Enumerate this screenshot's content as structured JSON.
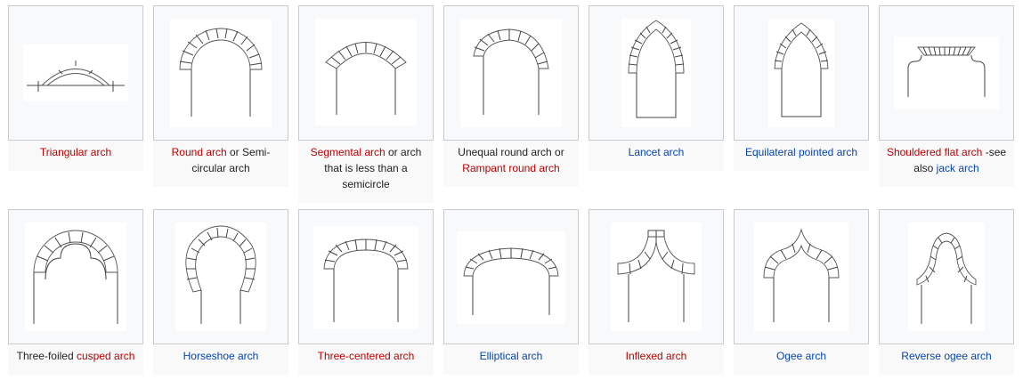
{
  "gallery": {
    "items": [
      {
        "key": "triangular",
        "caption": [
          {
            "text": "Triangular arch",
            "link": "red"
          }
        ]
      },
      {
        "key": "round",
        "caption": [
          {
            "text": "Round arch",
            "link": "red"
          },
          {
            "text": " or Semi-circular arch",
            "link": ""
          }
        ]
      },
      {
        "key": "segmental",
        "caption": [
          {
            "text": "Segmental arch",
            "link": "red"
          },
          {
            "text": " or arch that is less than a semicircle",
            "link": ""
          }
        ]
      },
      {
        "key": "unequal",
        "caption": [
          {
            "text": "Unequal round arch or ",
            "link": ""
          },
          {
            "text": "Rampant round arch",
            "link": "red"
          }
        ]
      },
      {
        "key": "lancet",
        "caption": [
          {
            "text": "Lancet arch",
            "link": "blue"
          }
        ]
      },
      {
        "key": "equilateral",
        "caption": [
          {
            "text": "Equilateral pointed arch",
            "link": "blue"
          }
        ]
      },
      {
        "key": "shouldered",
        "caption": [
          {
            "text": "Shouldered flat arch",
            "link": "red"
          },
          {
            "text": " -see also ",
            "link": ""
          },
          {
            "text": "jack arch",
            "link": "blue"
          }
        ]
      },
      {
        "key": "cusped",
        "caption": [
          {
            "text": "Three-foiled ",
            "link": ""
          },
          {
            "text": "cusped arch",
            "link": "red"
          }
        ]
      },
      {
        "key": "horseshoe",
        "caption": [
          {
            "text": "Horseshoe arch",
            "link": "blue"
          }
        ]
      },
      {
        "key": "threecentered",
        "caption": [
          {
            "text": "Three-centered arch",
            "link": "red"
          }
        ]
      },
      {
        "key": "elliptical",
        "caption": [
          {
            "text": "Elliptical arch",
            "link": "blue"
          }
        ]
      },
      {
        "key": "inflexed",
        "caption": [
          {
            "text": "Inflexed arch",
            "link": "red"
          }
        ]
      },
      {
        "key": "ogee",
        "caption": [
          {
            "text": "Ogee arch",
            "link": "blue"
          }
        ]
      },
      {
        "key": "reverseogee",
        "caption": [
          {
            "text": "Reverse ogee arch",
            "link": "blue"
          }
        ]
      }
    ]
  }
}
